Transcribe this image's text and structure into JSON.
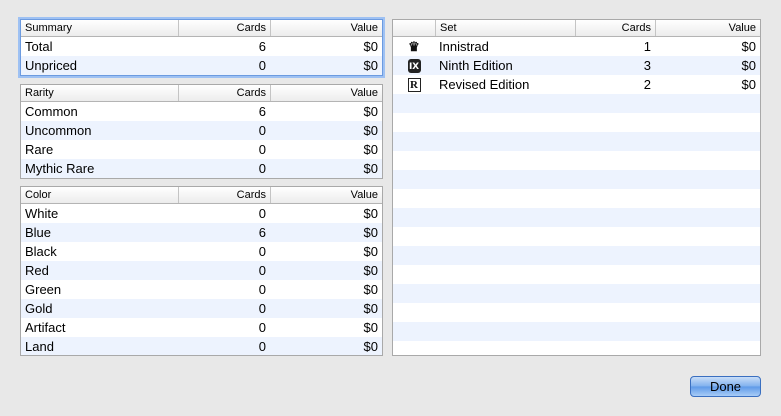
{
  "summary": {
    "headers": {
      "label": "Summary",
      "cards": "Cards",
      "value": "Value"
    },
    "rows": [
      {
        "label": "Total",
        "cards": "6",
        "value": "$0"
      },
      {
        "label": "Unpriced",
        "cards": "0",
        "value": "$0"
      }
    ]
  },
  "rarity": {
    "headers": {
      "label": "Rarity",
      "cards": "Cards",
      "value": "Value"
    },
    "rows": [
      {
        "label": "Common",
        "cards": "6",
        "value": "$0"
      },
      {
        "label": "Uncommon",
        "cards": "0",
        "value": "$0"
      },
      {
        "label": "Rare",
        "cards": "0",
        "value": "$0"
      },
      {
        "label": "Mythic Rare",
        "cards": "0",
        "value": "$0"
      }
    ]
  },
  "color": {
    "headers": {
      "label": "Color",
      "cards": "Cards",
      "value": "Value"
    },
    "rows": [
      {
        "label": "White",
        "cards": "0",
        "value": "$0"
      },
      {
        "label": "Blue",
        "cards": "6",
        "value": "$0"
      },
      {
        "label": "Black",
        "cards": "0",
        "value": "$0"
      },
      {
        "label": "Red",
        "cards": "0",
        "value": "$0"
      },
      {
        "label": "Green",
        "cards": "0",
        "value": "$0"
      },
      {
        "label": "Gold",
        "cards": "0",
        "value": "$0"
      },
      {
        "label": "Artifact",
        "cards": "0",
        "value": "$0"
      },
      {
        "label": "Land",
        "cards": "0",
        "value": "$0"
      }
    ]
  },
  "sets": {
    "headers": {
      "icon": "",
      "set": "Set",
      "cards": "Cards",
      "value": "Value"
    },
    "rows": [
      {
        "icon": "innistrad-set-icon",
        "glyph": "♛",
        "set": "Innistrad",
        "cards": "1",
        "value": "$0"
      },
      {
        "icon": "ninth-edition-set-icon",
        "glyph": "Ⅸ",
        "set": "Ninth Edition",
        "cards": "3",
        "value": "$0"
      },
      {
        "icon": "revised-edition-set-icon",
        "glyph": "R",
        "set": "Revised Edition",
        "cards": "2",
        "value": "$0"
      }
    ]
  },
  "footer": {
    "done_label": "Done"
  },
  "colors": {
    "selection_border": "#6c9be0",
    "row_stripe": "#edf3fe",
    "button_blue": "#5d99e8"
  }
}
